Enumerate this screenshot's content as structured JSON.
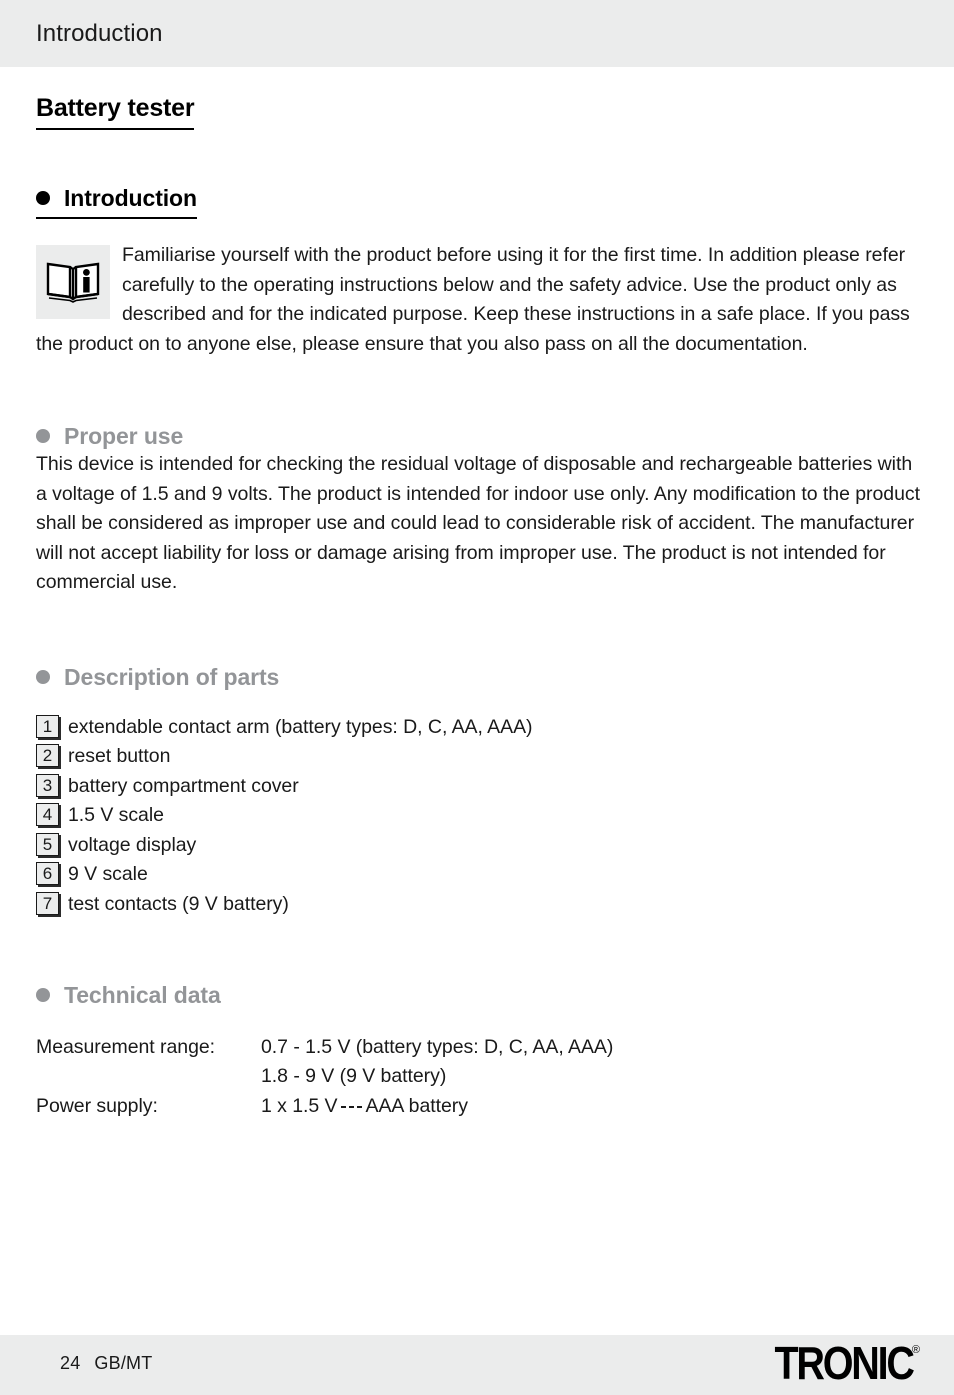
{
  "header": {
    "running_title": "Introduction"
  },
  "doc_title": "Battery tester",
  "sections": {
    "introduction": {
      "heading": "Introduction",
      "icon": "open-book-info-icon",
      "paragraph": "Familiarise yourself with the product before using it for the first time. In addition please refer carefully to the operating instructions below and the safety advice. Use the product only as described and for the indicated purpose. Keep these instructions in a safe place. If you pass the product on to anyone else, please ensure that you also pass on all the documentation."
    },
    "proper_use": {
      "heading": "Proper use",
      "paragraph": "This device is intended for checking the residual voltage of disposable and rechargeable batteries with a voltage of 1.5 and 9 volts. The product is intended for indoor use only. Any modification to the product shall be considered as improper use and could lead to considerable risk of accident. The manufacturer will not accept liability for loss or damage arising from improper use. The product is not intended for commercial use."
    },
    "description_of_parts": {
      "heading": "Description of parts",
      "items": [
        {
          "number": "1",
          "label": "extendable contact arm (battery types: D, C, AA, AAA)"
        },
        {
          "number": "2",
          "label": "reset button"
        },
        {
          "number": "3",
          "label": "battery compartment cover"
        },
        {
          "number": "4",
          "label": "1.5 V scale"
        },
        {
          "number": "5",
          "label": "voltage display"
        },
        {
          "number": "6",
          "label": "9 V scale"
        },
        {
          "number": "7",
          "label": "test contacts (9 V battery)"
        }
      ]
    },
    "technical_data": {
      "heading": "Technical data",
      "rows": [
        {
          "label": "Measurement range:",
          "value_line_1": "0.7 - 1.5 V (battery types: D, C, AA, AAA)",
          "value_line_2": "1.8 - 9 V (9 V battery)"
        },
        {
          "label": "Power supply:",
          "value_prefix": "1 x 1.5 V",
          "symbol": "dc-current-symbol",
          "value_suffix": "AAA battery"
        }
      ]
    }
  },
  "footer": {
    "page_number": "24",
    "language": "GB/MT",
    "brand": "TRONIC",
    "brand_mark": "®"
  },
  "colors": {
    "band_gray": "#ebecec",
    "heading_gray": "#939598",
    "text_black": "#1a1a1a"
  }
}
